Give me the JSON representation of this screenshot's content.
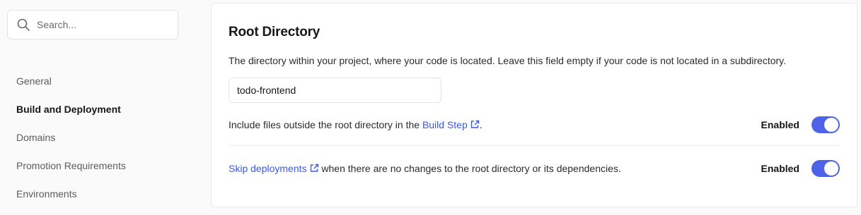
{
  "search": {
    "placeholder": "Search..."
  },
  "nav": {
    "items": [
      {
        "label": "General"
      },
      {
        "label": "Build and Deployment",
        "active": true
      },
      {
        "label": "Domains"
      },
      {
        "label": "Promotion Requirements"
      },
      {
        "label": "Environments"
      }
    ]
  },
  "section": {
    "title": "Root Directory",
    "description": "The directory within your project, where your code is located. Leave this field empty if your code is not located in a subdirectory.",
    "root_directory_value": "todo-frontend",
    "include_files": {
      "text_before": "Include files outside the root directory in the ",
      "link_label": "Build Step",
      "text_after": ".",
      "status": "Enabled",
      "enabled": true
    },
    "skip_deployments": {
      "link_label": "Skip deployments",
      "text_after": " when there are no changes to the root directory or its dependencies.",
      "status": "Enabled",
      "enabled": true
    }
  },
  "colors": {
    "accent": "#4d63e8",
    "link": "#3858e9"
  },
  "icons": {
    "search": "search-icon",
    "external": "external-link-icon"
  }
}
